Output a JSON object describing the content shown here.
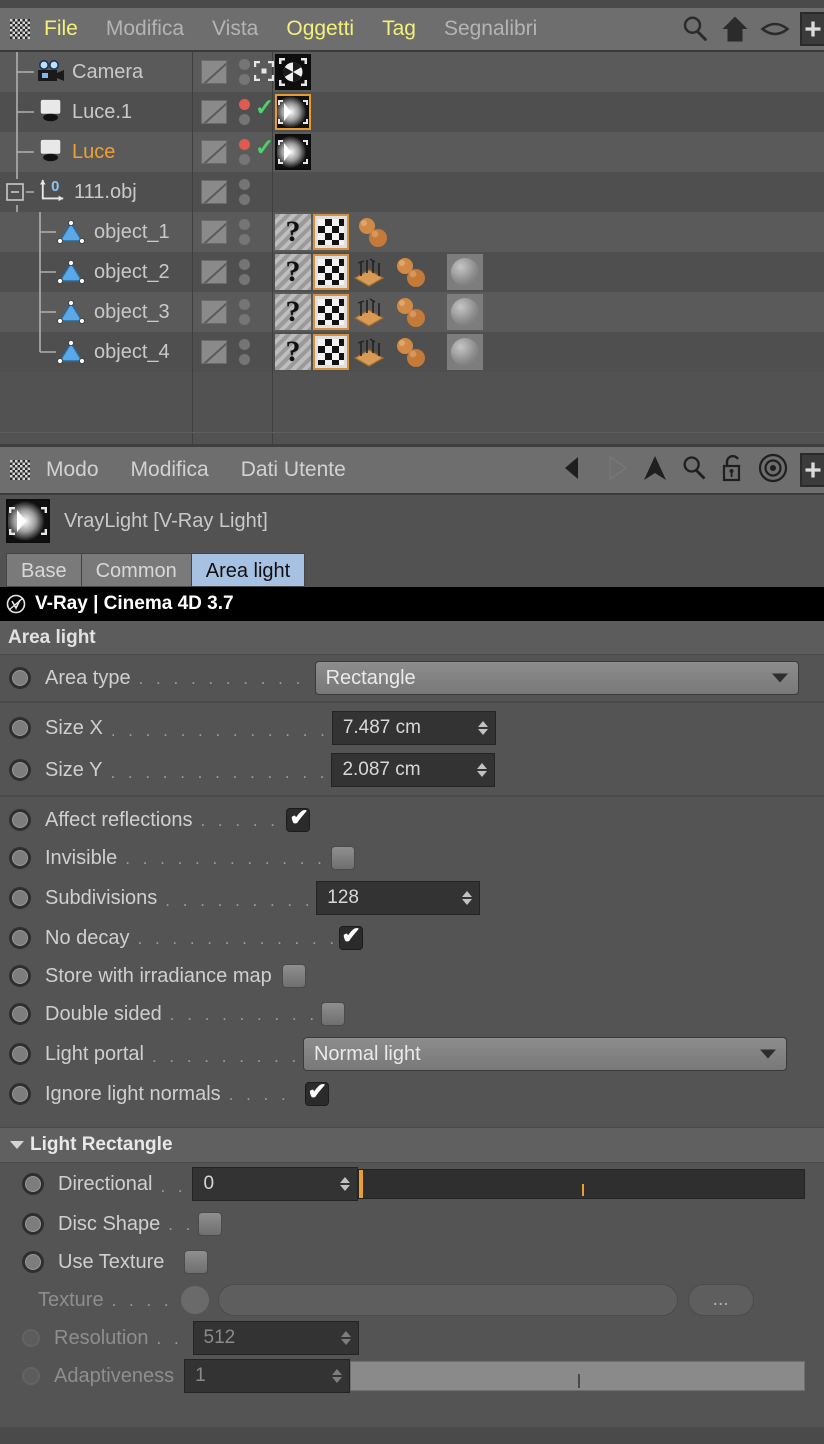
{
  "menubar": {
    "items": [
      {
        "label": "File",
        "state": "active"
      },
      {
        "label": "Modifica",
        "state": "dim"
      },
      {
        "label": "Vista",
        "state": "dim"
      },
      {
        "label": "Oggetti",
        "state": "active"
      },
      {
        "label": "Tag",
        "state": "active"
      },
      {
        "label": "Segnalibri",
        "state": "dim"
      }
    ],
    "icons": [
      "search-icon",
      "home-icon",
      "eye-icon",
      "plus-icon"
    ]
  },
  "object_manager": {
    "rows": [
      {
        "name": "Camera",
        "icon": "camera-icon",
        "selected": false,
        "indent": 1,
        "dots": {
          "editor": "gray",
          "render": "gray"
        },
        "check": false,
        "move": true,
        "tags": [
          "camera-tag"
        ]
      },
      {
        "name": "Luce.1",
        "icon": "light-icon",
        "selected": false,
        "indent": 1,
        "dots": {
          "editor": "red",
          "render": "gray"
        },
        "check": true,
        "move": false,
        "tags": [
          "vray-light-tag-selected"
        ]
      },
      {
        "name": "Luce",
        "icon": "light-icon",
        "selected": true,
        "indent": 1,
        "dots": {
          "editor": "red",
          "render": "gray"
        },
        "check": true,
        "move": false,
        "tags": [
          "vray-light-tag"
        ]
      },
      {
        "name": "111.obj",
        "icon": "null-object-icon",
        "selected": false,
        "indent": 0,
        "dots": {
          "editor": "gray",
          "render": "gray"
        },
        "check": false,
        "move": false,
        "tags": []
      },
      {
        "name": "object_1",
        "icon": "polygon-object-icon",
        "selected": false,
        "indent": 2,
        "dots": {
          "editor": "gray",
          "render": "gray"
        },
        "check": false,
        "move": false,
        "tags": [
          "unknown-tag",
          "checker-texture-tag",
          "material-tag"
        ]
      },
      {
        "name": "object_2",
        "icon": "polygon-object-icon",
        "selected": false,
        "indent": 2,
        "dots": {
          "editor": "gray",
          "render": "gray"
        },
        "check": false,
        "move": false,
        "tags": [
          "unknown-tag",
          "checker-texture-tag",
          "uvw-tag",
          "material-tag",
          "sphere-material-tag"
        ]
      },
      {
        "name": "object_3",
        "icon": "polygon-object-icon",
        "selected": false,
        "indent": 2,
        "dots": {
          "editor": "gray",
          "render": "gray"
        },
        "check": false,
        "move": false,
        "tags": [
          "unknown-tag",
          "checker-texture-tag",
          "uvw-tag",
          "material-tag",
          "sphere-material-tag"
        ]
      },
      {
        "name": "object_4",
        "icon": "polygon-object-icon",
        "selected": false,
        "indent": 2,
        "dots": {
          "editor": "gray",
          "render": "gray"
        },
        "check": false,
        "move": false,
        "tags": [
          "unknown-tag",
          "checker-texture-tag",
          "uvw-tag",
          "material-tag",
          "sphere-material-tag"
        ]
      }
    ],
    "expand_state": "expanded",
    "null_index_badge": "0"
  },
  "attribute_manager": {
    "menu": [
      "Modo",
      "Modifica",
      "Dati Utente"
    ],
    "icons": [
      "back-arrow-icon",
      "forward-arrow-icon",
      "up-arrow-icon",
      "search-icon",
      "unlock-icon",
      "target-icon",
      "plus-icon"
    ],
    "object_title": "VrayLight [V-Ray Light]",
    "object_icon": "vray-light-icon",
    "tabs": [
      {
        "label": "Base",
        "active": false
      },
      {
        "label": "Common",
        "active": false
      },
      {
        "label": "Area light",
        "active": true
      }
    ],
    "banner": {
      "text": "V-Ray | Cinema 4D  3.7",
      "icon": "vray-logo-icon"
    }
  },
  "area_light": {
    "section_title": "Area light",
    "area_type": {
      "label": "Area type",
      "value": "Rectangle",
      "type": "combo"
    },
    "size_x": {
      "label": "Size X",
      "value": "7.487 cm",
      "type": "number"
    },
    "size_y": {
      "label": "Size Y",
      "value": "2.087 cm",
      "type": "number"
    },
    "affect_reflections": {
      "label": "Affect reflections",
      "value": true,
      "type": "checkbox"
    },
    "invisible": {
      "label": "Invisible",
      "value": false,
      "type": "checkbox"
    },
    "subdivisions": {
      "label": "Subdivisions",
      "value": "128",
      "type": "number"
    },
    "no_decay": {
      "label": "No decay",
      "value": true,
      "type": "checkbox"
    },
    "store_with_irradiance_map": {
      "label": "Store with irradiance map",
      "value": false,
      "type": "checkbox"
    },
    "double_sided": {
      "label": "Double sided",
      "value": false,
      "type": "checkbox"
    },
    "light_portal": {
      "label": "Light portal",
      "value": "Normal light",
      "type": "combo"
    },
    "ignore_light_normals": {
      "label": "Ignore light normals",
      "value": true,
      "type": "checkbox"
    }
  },
  "light_rectangle": {
    "section_title": "Light Rectangle",
    "directional": {
      "label": "Directional",
      "value": "0",
      "type": "slider",
      "percent": 0
    },
    "disc_shape": {
      "label": "Disc Shape",
      "value": false,
      "type": "checkbox"
    },
    "use_texture": {
      "label": "Use Texture",
      "value": false,
      "type": "checkbox"
    },
    "texture": {
      "label": "Texture",
      "value": "",
      "type": "texture",
      "button": "...",
      "disabled": true
    },
    "resolution": {
      "label": "Resolution",
      "value": "512",
      "type": "number",
      "disabled": true
    },
    "adaptiveness": {
      "label": "Adaptiveness",
      "value": "1",
      "type": "slider",
      "percent": 100,
      "disabled": true
    }
  },
  "colors": {
    "accent_yellow": "#f5f07a",
    "selected_orange": "#f0a030",
    "tab_active_blue": "#a7c1e2",
    "slider_orange": "#e8a030",
    "check_green": "#4ed06a",
    "dot_red": "#e05a52",
    "panel_bg": "#545454"
  }
}
